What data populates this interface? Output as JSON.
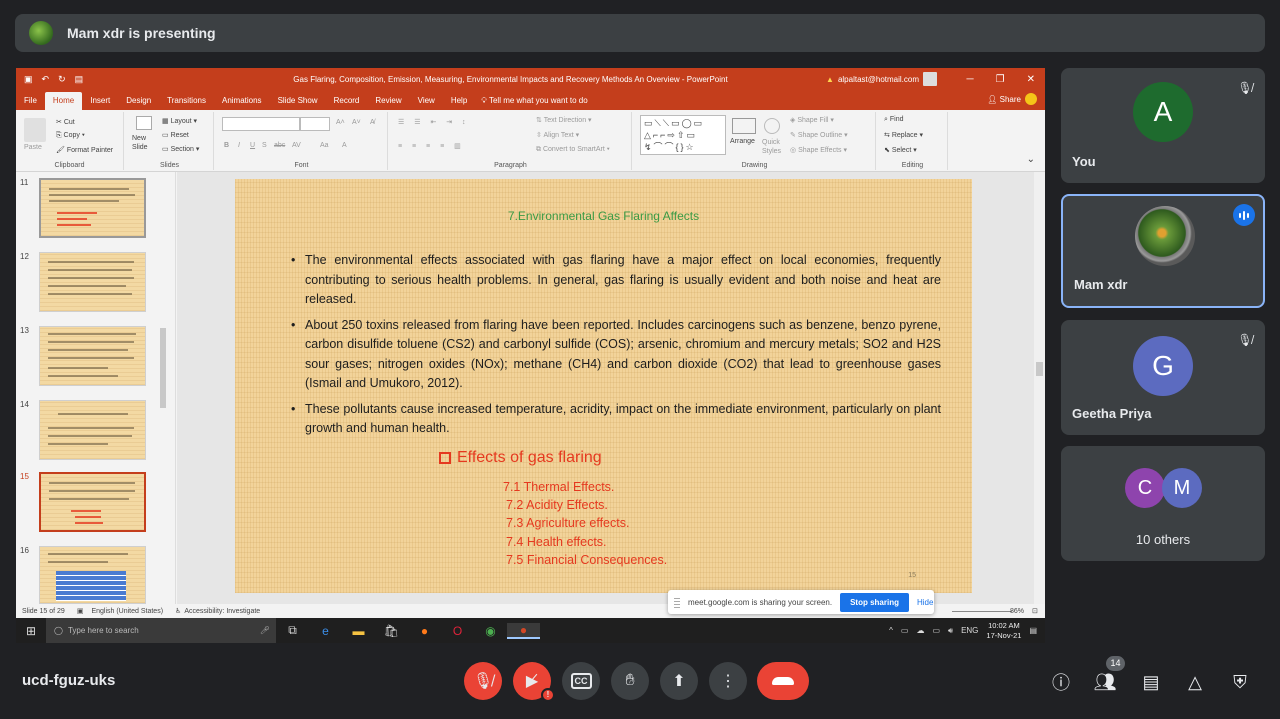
{
  "banner": {
    "text": "Mam xdr is presenting"
  },
  "ppt": {
    "title": "Gas Flaring, Composition, Emission, Measuring, Environmental Impacts and Recovery Methods An Overview  -  PowerPoint",
    "account": "alpaltast@hotmail.com",
    "menu": [
      "File",
      "Home",
      "Insert",
      "Design",
      "Transitions",
      "Animations",
      "Slide Show",
      "Record",
      "Review",
      "View",
      "Help"
    ],
    "tell_me": "Tell me what you want to do",
    "share": "Share",
    "ribbon": {
      "clipboard": {
        "paste": "Paste",
        "cut": "Cut",
        "copy": "Copy",
        "format_painter": "Format Painter",
        "label": "Clipboard"
      },
      "slides": {
        "new_slide": "New Slide",
        "layout": "Layout",
        "reset": "Reset",
        "section": "Section",
        "label": "Slides"
      },
      "font": {
        "label": "Font"
      },
      "paragraph": {
        "text_direction": "Text Direction",
        "align_text": "Align Text",
        "convert": "Convert to SmartArt",
        "label": "Paragraph"
      },
      "drawing": {
        "arrange": "Arrange",
        "quick_styles": "Quick Styles",
        "shape_fill": "Shape Fill",
        "shape_outline": "Shape Outline",
        "shape_effects": "Shape Effects",
        "label": "Drawing"
      },
      "editing": {
        "find": "Find",
        "replace": "Replace",
        "select": "Select",
        "label": "Editing"
      }
    },
    "thumbnails": [
      {
        "num": "11"
      },
      {
        "num": "12"
      },
      {
        "num": "13"
      },
      {
        "num": "14"
      },
      {
        "num": "15",
        "selected": true
      },
      {
        "num": "16"
      }
    ],
    "slide": {
      "title": "7.Environmental Gas Flaring Affects",
      "bullets": [
        "The environmental effects associated with gas flaring have a major effect on local economies, frequently contributing to serious health problems. In general, gas flaring is usually evident and both noise and heat are released.",
        "About 250 toxins released from flaring have been reported. Includes carcinogens such as benzene, benzo pyrene, carbon disulfide toluene (CS2) and carbonyl sulfide (COS); arsenic, chromium and mercury metals; SO2 and H2S sour gases; nitrogen oxides (NOx); methane (CH4) and carbon dioxide (CO2) that lead to greenhouse gases (Ismail and Umukoro, 2012).",
        "These pollutants cause increased temperature, acridity, impact on the immediate environment, particularly on plant growth and human health."
      ],
      "effects_heading": "Effects of gas flaring",
      "effects": [
        "7.1 Thermal Effects.",
        "7.2 Acidity Effects.",
        "7.3 Agriculture effects.",
        "7.4 Health effects.",
        "7.5 Financial Consequences."
      ],
      "page_number": "15"
    },
    "status": {
      "slide": "Slide 15 of 29",
      "language": "English (United States)",
      "accessibility": "Accessibility: Investigate",
      "zoom": "86%"
    }
  },
  "share_popup": {
    "text": "meet.google.com is sharing your screen.",
    "stop": "Stop sharing",
    "hide": "Hide"
  },
  "taskbar": {
    "search_placeholder": "Type here to search",
    "lang": "ENG",
    "time": "10:02 AM",
    "date": "17-Nov-21"
  },
  "participants": [
    {
      "name": "You",
      "initial": "A",
      "color": "#1e6b2e"
    },
    {
      "name": "Mam xdr"
    },
    {
      "name": "Geetha Priya",
      "initial": "G",
      "color": "#5c6bc0"
    },
    {
      "name": "10 others",
      "initials": [
        "C",
        "M"
      ],
      "colors": [
        "#8e44ad",
        "#5c6bc0"
      ]
    }
  ],
  "meeting": {
    "code": "ucd-fguz-uks",
    "participant_count": "14"
  }
}
